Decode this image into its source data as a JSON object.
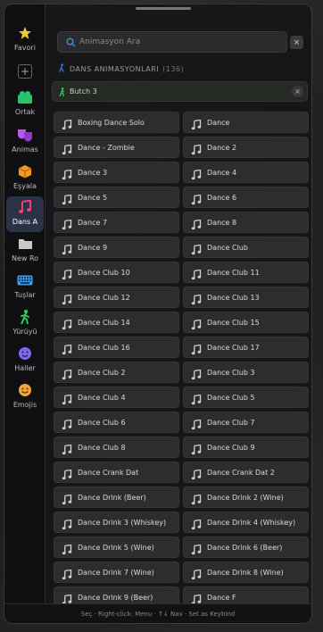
{
  "sidebar": {
    "items": [
      {
        "label": "Favori",
        "icon": "star-icon",
        "color": "#f2c531"
      },
      {
        "label": "Ortak",
        "icon": "people-icon",
        "color": "#27c46d"
      },
      {
        "label": "Animas",
        "icon": "theater-masks-icon",
        "color": "#b45be8"
      },
      {
        "label": "Eşyala",
        "icon": "box-icon",
        "color": "#f59a1d"
      },
      {
        "label": "Dans A",
        "icon": "music-note-icon",
        "color": "#ef3f78"
      },
      {
        "label": "New Ro",
        "icon": "folder-icon",
        "color": "#c9c9c9"
      },
      {
        "label": "Tuşlar",
        "icon": "keyboard-icon",
        "color": "#3e9bea"
      },
      {
        "label": "Yürüyü",
        "icon": "walking-icon",
        "color": "#2fd15f"
      },
      {
        "label": "Haller",
        "icon": "smiley-icon",
        "color": "#7a6cf0"
      },
      {
        "label": "Emojis",
        "icon": "emoji-icon",
        "color": "#f0a63a"
      }
    ],
    "add_label": "+"
  },
  "search": {
    "placeholder": "Animasyon Ara",
    "close_label": "×"
  },
  "section": {
    "title": "DANS ANIMASYONLARI",
    "count": "(136)"
  },
  "filter": {
    "label": "Butch 3",
    "close_label": "×"
  },
  "animations": [
    "Boxing Dance Solo",
    "Dance",
    "Dance - Zombie",
    "Dance 2",
    "Dance 3",
    "Dance 4",
    "Dance 5",
    "Dance 6",
    "Dance 7",
    "Dance 8",
    "Dance 9",
    "Dance Club",
    "Dance Club 10",
    "Dance Club 11",
    "Dance Club 12",
    "Dance Club 13",
    "Dance Club 14",
    "Dance Club 15",
    "Dance Club 16",
    "Dance Club 17",
    "Dance Club 2",
    "Dance Club 3",
    "Dance Club 4",
    "Dance Club 5",
    "Dance Club 6",
    "Dance Club 7",
    "Dance Club 8",
    "Dance Club 9",
    "Dance Crank Dat",
    "Dance Crank Dat 2",
    "Dance Drink (Beer)",
    "Dance Drink 2 (Wine)",
    "Dance Drink 3 (Whiskey)",
    "Dance Drink 4 (Whiskey)",
    "Dance Drink 5 (Wine)",
    "Dance Drink 6 (Beer)",
    "Dance Drink 7 (Wine)",
    "Dance Drink 8 (Wine)",
    "Dance Drink 9 (Beer)",
    "Dance F"
  ],
  "footer": {
    "text": "Seç · Right-click: Menu · ↑↓ Nav · Set as Keybind"
  },
  "colors": {
    "accent": "#2a3345",
    "note_icon": "#cfcfcf",
    "walker": "#2fd15f"
  }
}
